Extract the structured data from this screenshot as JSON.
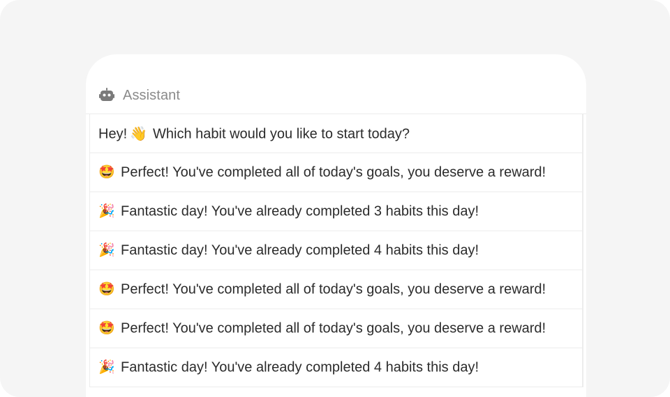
{
  "header": {
    "icon": "robot-icon",
    "title": "Assistant"
  },
  "messages": [
    {
      "emoji": "",
      "text": "Hey!",
      "wave": "👋",
      "text_after": "Which habit would you like to start today?"
    },
    {
      "emoji": "🤩",
      "text": "Perfect! You've completed all of today's goals, you deserve a reward!"
    },
    {
      "emoji": "🎉",
      "text": "Fantastic day! You've already completed 3 habits this day!"
    },
    {
      "emoji": "🎉",
      "text": "Fantastic day! You've already completed 4 habits this day!"
    },
    {
      "emoji": "🤩",
      "text": "Perfect! You've completed all of today's goals, you deserve a reward!"
    },
    {
      "emoji": "🤩",
      "text": "Perfect! You've completed all of today's goals, you deserve a reward!"
    },
    {
      "emoji": "🎉",
      "text": "Fantastic day! You've already completed 4 habits this day!"
    }
  ]
}
